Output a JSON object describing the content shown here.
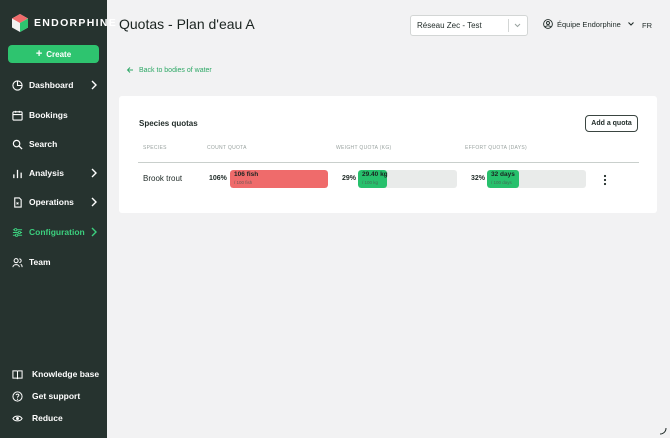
{
  "brand": {
    "name": "ENDORPHINE"
  },
  "sidebar": {
    "create_label": "Create",
    "items": [
      {
        "label": "Dashboard",
        "icon": "dashboard-icon",
        "chevron": true,
        "active": false
      },
      {
        "label": "Bookings",
        "icon": "calendar-icon",
        "chevron": false,
        "active": false
      },
      {
        "label": "Search",
        "icon": "search-icon",
        "chevron": false,
        "active": false
      },
      {
        "label": "Analysis",
        "icon": "chart-icon",
        "chevron": true,
        "active": false
      },
      {
        "label": "Operations",
        "icon": "document-icon",
        "chevron": true,
        "active": false
      },
      {
        "label": "Configuration",
        "icon": "sliders-icon",
        "chevron": true,
        "active": true
      },
      {
        "label": "Team",
        "icon": "users-icon",
        "chevron": false,
        "active": false
      }
    ],
    "bottom": [
      {
        "label": "Knowledge base",
        "icon": "book-icon"
      },
      {
        "label": "Get support",
        "icon": "help-icon"
      },
      {
        "label": "Reduce",
        "icon": "eye-icon"
      }
    ]
  },
  "header": {
    "title": "Quotas - Plan d'eau A",
    "network_select": "Réseau Zec - Test",
    "team": "Équipe Endorphine",
    "lang": "FR"
  },
  "back_link": "Back to bodies of water",
  "quotas": {
    "title": "Species quotas",
    "add_label": "Add a quota",
    "columns": [
      "SPECIES",
      "COUNT QUOTA",
      "WEIGHT QUOTA (KG)",
      "EFFORT QUOTA (DAYS)"
    ],
    "rows": [
      {
        "species": "Brook trout",
        "count": {
          "percent": "106%",
          "main": "106 fish",
          "sub": "/ 100 fish",
          "fill": 1.0,
          "color": "#ef6b6b"
        },
        "weight": {
          "percent": "29%",
          "main": "29.40 kg",
          "sub": "/ 100 kg",
          "fill": 0.29,
          "color": "#27c06c"
        },
        "effort": {
          "percent": "32%",
          "main": "32 days",
          "sub": "/ 100 days",
          "fill": 0.32,
          "color": "#27c06c"
        }
      }
    ]
  },
  "colors": {
    "sidebar": "#26332f",
    "accent": "#2ec46f",
    "danger": "#ef6b6b",
    "link": "#2ea866"
  }
}
